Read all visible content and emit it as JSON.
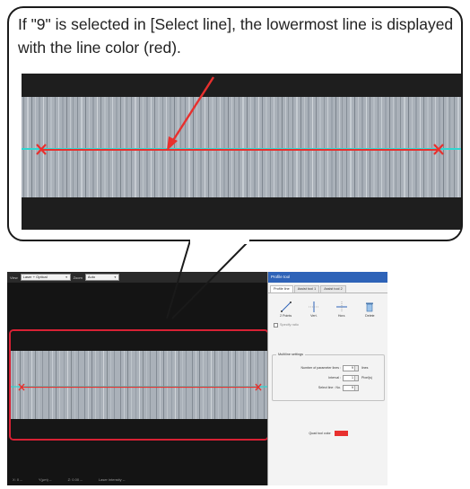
{
  "callout": {
    "text": "If \"9\" is selected in [Select line], the lowermost line is displayed with the line color (red)."
  },
  "colors": {
    "line_color": "#e8302e",
    "guide_line": "#2fd6d0",
    "highlight_frame": "#d82134",
    "panel_title_bar": "#2e63b8"
  },
  "toolbar": {
    "view_label": "View",
    "view_value": "Laser + Optical",
    "zoom_label": "Zoom",
    "zoom_value": "Auto"
  },
  "status_bar": {
    "items": [
      "X: 0  --",
      "Y(µm)  --",
      "Z: 0.00  --",
      "Laser intensity  --"
    ]
  },
  "panel": {
    "title": "Profile tool",
    "tabs": [
      "Profile line",
      "Assist tool 1",
      "Assist tool 2"
    ],
    "tools": [
      {
        "label": "2 Points",
        "icon": "diagonal-line-icon"
      },
      {
        "label": "Vert.",
        "icon": "vertical-line-icon"
      },
      {
        "label": "Horz.",
        "icon": "horizontal-line-icon"
      },
      {
        "label": "Delete",
        "icon": "trash-icon"
      }
    ],
    "specify_ratio_label": "Specify ratio",
    "multiline": {
      "title": "Multiline settings",
      "rows": [
        {
          "label": "Number of parameter lines :",
          "value": "9",
          "unit": "lines"
        },
        {
          "label": "Interval :",
          "value": "1",
          "unit": "Pixel(s)"
        },
        {
          "label": "Select line :  No.",
          "value": "9",
          "unit": ""
        }
      ]
    },
    "quad_tool_label": "Quad tool color",
    "quad_tool_color": "#e8302e"
  }
}
